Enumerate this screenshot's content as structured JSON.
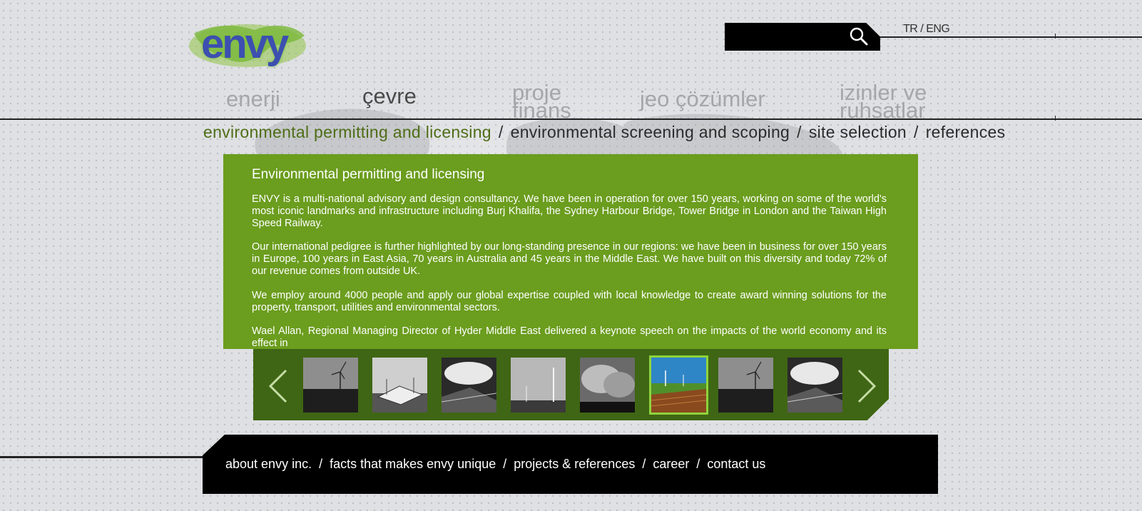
{
  "logo": {
    "text": "envy"
  },
  "search": {
    "value": "",
    "icon": "magnifier-icon"
  },
  "language": {
    "tr": "TR",
    "separator": "/",
    "eng": "ENG"
  },
  "main_nav": [
    {
      "label": "enerji",
      "active": false
    },
    {
      "label": "çevre",
      "active": true
    },
    {
      "label": "proje finans",
      "active": false
    },
    {
      "label": "jeo çözümler",
      "active": false
    },
    {
      "label": "izinler ve ruhsatlar",
      "active": false
    }
  ],
  "sub_nav": [
    {
      "label": "environmental permitting and licensing",
      "active": true
    },
    {
      "label": "environmental screening and scoping",
      "active": false
    },
    {
      "label": "site selection",
      "active": false
    },
    {
      "label": "references",
      "active": false
    }
  ],
  "sub_nav_separator": "/",
  "content": {
    "title": "Environmental permitting and licensing",
    "paragraphs": [
      "ENVY  is a multi-national advisory and design consultancy. We have been in operation for over 150 years, working on some of the world's most iconic landmarks and infrastructure including Burj Khalifa, the Sydney Harbour Bridge, Tower Bridge in London and the Taiwan High Speed Railway.",
      "Our international pedigree is further highlighted by our long-standing presence in our regions: we have been in business for over 150 years in Europe, 100 years in East Asia, 70 years in Australia and 45 years in the Middle East. We have built on this diversity and today 72% of our revenue comes from outside UK.",
      "We employ around 4000 people and apply our global expertise coupled with local knowledge to create award winning solutions for the property, transport, utilities and environmental sectors.",
      "Wael Allan, Regional Managing Director of Hyder Middle East delivered a keynote speech on the impacts of the world economy and its effect in"
    ]
  },
  "gallery": {
    "prev_icon": "chevron-left-icon",
    "next_icon": "chevron-right-icon",
    "active_index": 5,
    "thumbnails": [
      "wind-turbine-field",
      "solar-installation",
      "solar-panels-clouds",
      "wind-turbines-plain",
      "industrial-smoke",
      "wind-turbines-landscape",
      "wind-turbine-field",
      "solar-panels-clouds"
    ]
  },
  "footer": {
    "links": [
      "about envy inc.",
      "facts that makes envy unique",
      "projects & references",
      "career",
      "contact us"
    ],
    "separator": "/"
  },
  "colors": {
    "panel_green": "#6b9d1e",
    "gallery_green": "#3f6614",
    "active_subnav": "#4e6d16",
    "logo_blue": "#3d4fb0"
  }
}
